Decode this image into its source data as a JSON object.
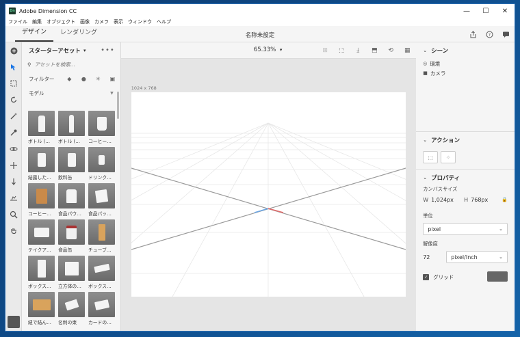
{
  "window": {
    "title": "Adobe Dimension CC",
    "logo_text": "Dn"
  },
  "menubar": [
    "ファイル",
    "編集",
    "オブジェクト",
    "画像",
    "カメラ",
    "表示",
    "ウィンドウ",
    "ヘルプ"
  ],
  "header": {
    "tabs": [
      "デザイン",
      "レンダリング"
    ],
    "active_tab": "デザイン",
    "doc_title": "名称未設定"
  },
  "assets": {
    "title": "スターターアセット",
    "search_placeholder": "アセットを検索...",
    "filter_label": "フィルター",
    "section_label": "モデル",
    "items": [
      {
        "label": "ボトル (…",
        "shape": "bottle"
      },
      {
        "label": "ボトル (…",
        "shape": "bottle-slim"
      },
      {
        "label": "コーヒー…",
        "shape": "cup"
      },
      {
        "label": "結露した…",
        "shape": "can"
      },
      {
        "label": "飲料缶",
        "shape": "can"
      },
      {
        "label": "ドリンク…",
        "shape": "can-small"
      },
      {
        "label": "コーヒー…",
        "shape": "bag"
      },
      {
        "label": "食品パウ…",
        "shape": "pouch"
      },
      {
        "label": "食品パッ…",
        "shape": "pack"
      },
      {
        "label": "テイクア…",
        "shape": "box-flat"
      },
      {
        "label": "食品缶",
        "shape": "tin"
      },
      {
        "label": "チューブ…",
        "shape": "tube"
      },
      {
        "label": "ボックス…",
        "shape": "tall-box"
      },
      {
        "label": "立方体の…",
        "shape": "cube"
      },
      {
        "label": "ボックス…",
        "shape": "flat-box"
      },
      {
        "label": "紐で結ん…",
        "shape": "parcel"
      },
      {
        "label": "名刺の束",
        "shape": "cards"
      },
      {
        "label": "カードの…",
        "shape": "card"
      }
    ]
  },
  "canvas": {
    "zoom": "65.33%",
    "size_label": "1024 x 768"
  },
  "right": {
    "scene_title": "シーン",
    "scene_items": [
      "環境",
      "カメラ"
    ],
    "action_title": "アクション",
    "properties_title": "プロパティ",
    "canvas_size_label": "カンバスサイズ",
    "width_prefix": "W",
    "width_value": "1,024px",
    "height_prefix": "H",
    "height_value": "768px",
    "unit_label": "単位",
    "unit_value": "pixel",
    "resolution_label": "解像度",
    "resolution_value": "72",
    "resolution_unit": "pixel/Inch",
    "grid_label": "グリッド"
  },
  "colors": {
    "accent": "#1473e6",
    "titlebar_border": "#2b6fb5",
    "grid_swatch": "#666666"
  }
}
